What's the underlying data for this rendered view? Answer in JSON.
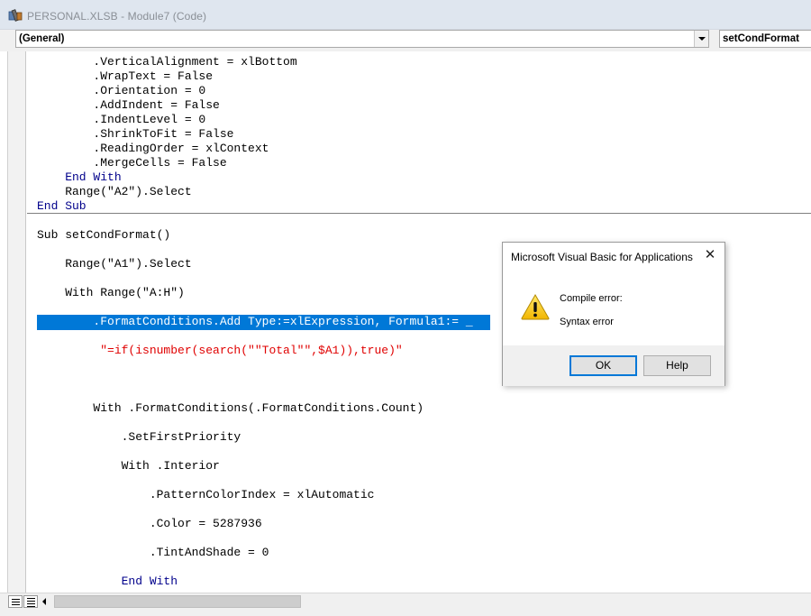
{
  "window": {
    "title": "PERSONAL.XLSB - Module7 (Code)",
    "app_icon": "vba-icon"
  },
  "toolbar": {
    "object_combo": "(General)",
    "procedure_combo": "setCondFormat"
  },
  "code": {
    "lines": [
      "        .VerticalAlignment = xlBottom",
      "        .WrapText = False",
      "        .Orientation = 0",
      "        .AddIndent = False",
      "        .IndentLevel = 0",
      "        .ShrinkToFit = False",
      "        .ReadingOrder = xlContext",
      "        .MergeCells = False",
      "    End With",
      "    Range(\"A2\").Select",
      "End Sub",
      "Sub setCondFormat()",
      "    Range(\"A1\").Select",
      "    With Range(\"A:H\")",
      "        .FormatConditions.Add Type:=xlExpression, Formula1:= _",
      "         \"=if(isnumber(search(\"\"Total\"\",$A1)),true)\"",
      "        With .FormatConditions(.FormatConditions.Count)",
      "            .SetFirstPriority",
      "            With .Interior",
      "                .PatternColorIndex = xlAutomatic",
      "                .Color = 5287936",
      "                .TintAndShade = 0",
      "            End With"
    ]
  },
  "dialog": {
    "title": "Microsoft Visual Basic for Applications",
    "close_label": "✕",
    "icon": "warning-icon",
    "message_line1": "Compile error:",
    "message_line2": "Syntax error",
    "ok_label": "OK",
    "help_label": "Help"
  },
  "colors": {
    "keyword": "#00008b",
    "error_text": "#e00000",
    "selection": "#0078d7"
  }
}
